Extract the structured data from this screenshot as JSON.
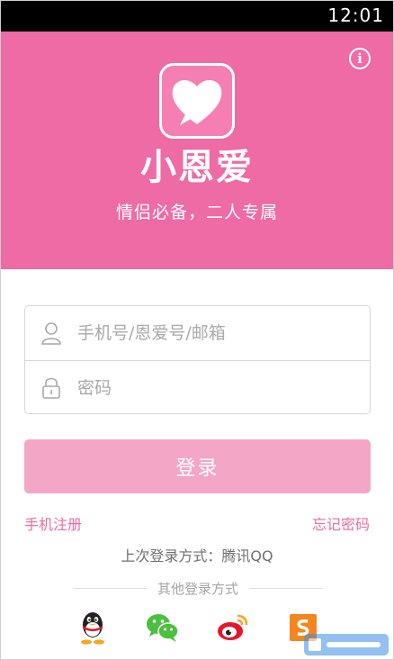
{
  "status_bar": {
    "time": "12:01"
  },
  "header": {
    "app_name": "小恩爱",
    "slogan": "情侣必备，二人专属",
    "logo_icon": "heart-icon",
    "info_icon": "info-icon",
    "info_glyph": "i"
  },
  "login_form": {
    "account_placeholder": "手机号/恩爱号/邮箱",
    "account_value": "",
    "account_icon": "user-icon",
    "password_placeholder": "密码",
    "password_value": "",
    "password_icon": "lock-icon"
  },
  "actions": {
    "login_label": "登录",
    "register_label": "手机注册",
    "forgot_label": "忘记密码"
  },
  "last_login": {
    "text": "上次登录方式：腾讯QQ"
  },
  "other_login": {
    "label": "其他登录方式",
    "providers": [
      {
        "name": "qq",
        "icon": "qq-penguin-icon"
      },
      {
        "name": "wechat",
        "icon": "wechat-icon"
      },
      {
        "name": "weibo",
        "icon": "weibo-icon"
      },
      {
        "name": "sohu",
        "icon": "sohu-icon"
      }
    ]
  },
  "colors": {
    "primary": "#ee6ba5",
    "button": "#f4a6c7",
    "placeholder": "#a9a9a9",
    "status_bar": "#000000"
  }
}
